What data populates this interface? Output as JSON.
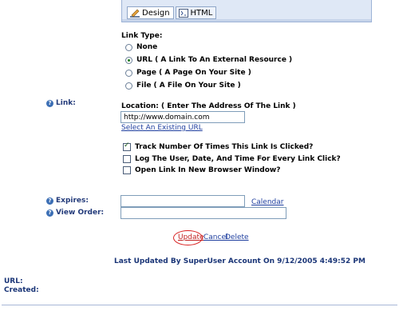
{
  "editor": {
    "tabs": [
      {
        "label": "Design",
        "icon": "design-icon",
        "active": true
      },
      {
        "label": "HTML",
        "icon": "html-icon",
        "active": false
      }
    ]
  },
  "link_type": {
    "heading": "Link Type:",
    "options": [
      {
        "label": "None",
        "selected": false
      },
      {
        "label": "URL ( A Link To An External Resource )",
        "selected": true
      },
      {
        "label": "Page ( A Page On Your Site )",
        "selected": false
      },
      {
        "label": "File ( A File On Your Site )",
        "selected": false
      }
    ]
  },
  "link": {
    "label": "Link:",
    "location_label": "Location: ( Enter The Address Of The Link )",
    "value": "http://www.domain.com",
    "select_existing": "Select An Existing URL"
  },
  "checkboxes": [
    {
      "label": "Track Number Of Times This Link Is Clicked?",
      "checked": true
    },
    {
      "label": "Log The User, Date, And Time For Every Link Click?",
      "checked": false
    },
    {
      "label": "Open Link In New Browser Window?",
      "checked": false
    }
  ],
  "expires": {
    "label": "Expires:",
    "value": "",
    "calendar": "Calendar"
  },
  "view_order": {
    "label": "View Order:",
    "value": ""
  },
  "actions": {
    "update": "Update",
    "cancel": "Cancel",
    "delete": "Delete"
  },
  "last_updated": "Last Updated By SuperUser Account On 9/12/2005 4:49:52 PM",
  "footer": {
    "url_label": "URL:",
    "created_label": "Created:"
  },
  "colors": {
    "accent": "#1a3577",
    "link": "#1f3f9f",
    "highlight_ring": "#d92020"
  }
}
